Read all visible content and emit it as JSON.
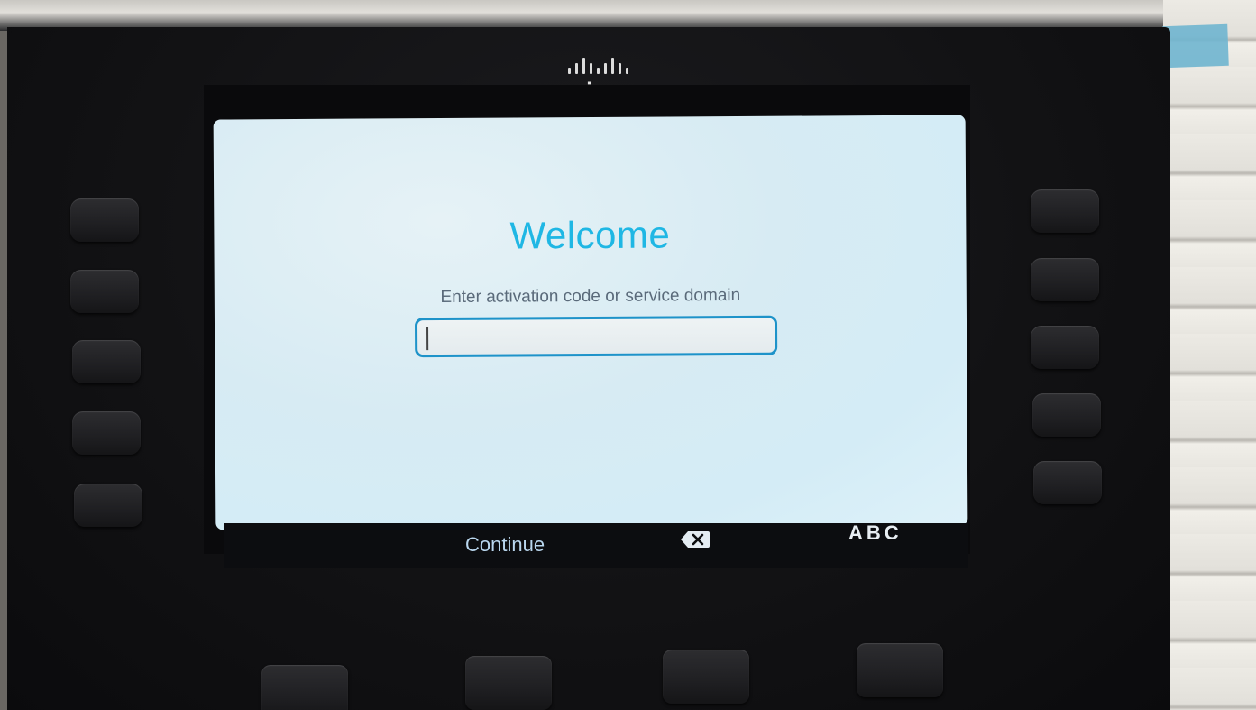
{
  "device": {
    "brand_logo": "cisco",
    "brand_icon": "cisco-bridge-icon"
  },
  "screen": {
    "title": "Welcome",
    "prompt": "Enter activation code or service domain",
    "input": {
      "value": "",
      "placeholder": ""
    },
    "accent_color": "#1fb7e4"
  },
  "softkeys": {
    "continue_label": "Continue",
    "backspace_icon": "backspace-icon",
    "abc_label": "ABC"
  }
}
